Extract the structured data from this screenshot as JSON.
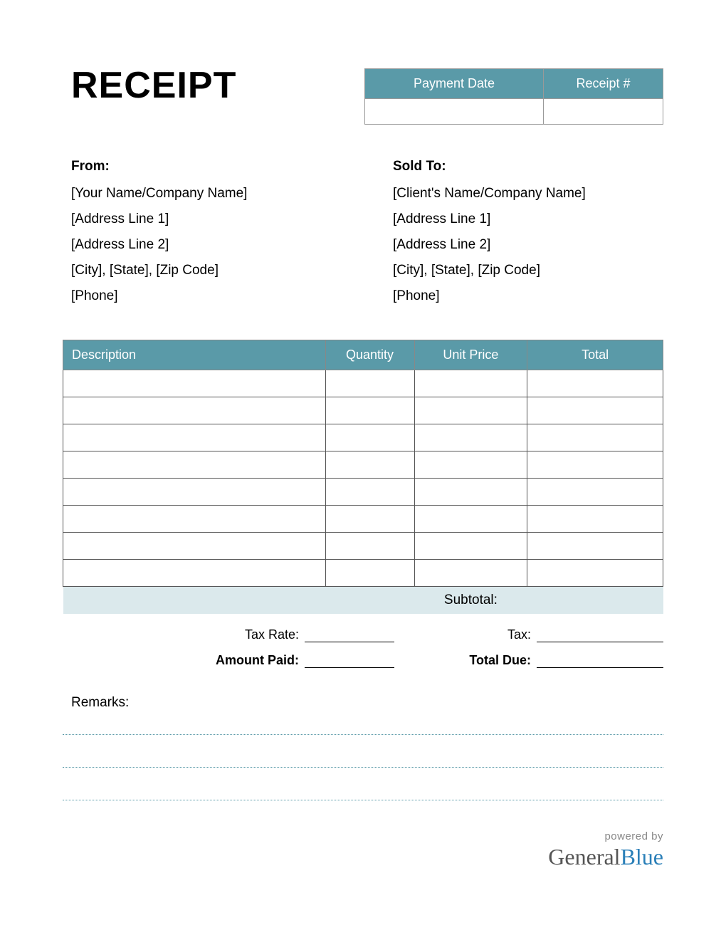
{
  "title": "RECEIPT",
  "meta": {
    "headers": [
      "Payment Date",
      "Receipt #"
    ],
    "values": [
      "",
      ""
    ]
  },
  "from": {
    "heading": "From:",
    "lines": [
      "[Your Name/Company Name]",
      "[Address Line 1]",
      "[Address Line 2]",
      "[City], [State], [Zip Code]",
      "[Phone]"
    ]
  },
  "sold_to": {
    "heading": "Sold To:",
    "lines": [
      "[Client's Name/Company Name]",
      "[Address Line 1]",
      "[Address Line 2]",
      "[City], [State], [Zip Code]",
      "[Phone]"
    ]
  },
  "items": {
    "headers": {
      "description": "Description",
      "quantity": "Quantity",
      "unit_price": "Unit Price",
      "total": "Total"
    },
    "rows": [
      {
        "description": "",
        "quantity": "",
        "unit_price": "",
        "total": ""
      },
      {
        "description": "",
        "quantity": "",
        "unit_price": "",
        "total": ""
      },
      {
        "description": "",
        "quantity": "",
        "unit_price": "",
        "total": ""
      },
      {
        "description": "",
        "quantity": "",
        "unit_price": "",
        "total": ""
      },
      {
        "description": "",
        "quantity": "",
        "unit_price": "",
        "total": ""
      },
      {
        "description": "",
        "quantity": "",
        "unit_price": "",
        "total": ""
      },
      {
        "description": "",
        "quantity": "",
        "unit_price": "",
        "total": ""
      },
      {
        "description": "",
        "quantity": "",
        "unit_price": "",
        "total": ""
      }
    ],
    "subtotal_label": "Subtotal:",
    "subtotal_value": ""
  },
  "totals": {
    "tax_rate_label": "Tax Rate:",
    "tax_rate_value": "",
    "tax_label": "Tax:",
    "tax_value": "",
    "amount_paid_label": "Amount Paid:",
    "amount_paid_value": "",
    "total_due_label": "Total Due:",
    "total_due_value": ""
  },
  "remarks": {
    "label": "Remarks:",
    "lines": [
      "",
      "",
      ""
    ]
  },
  "footer": {
    "powered_by": "powered by",
    "brand_general": "General",
    "brand_blue": "Blue"
  },
  "colors": {
    "accent": "#5a9aa8",
    "subtotal_bg": "#dbe9ec",
    "brand_blue": "#2a7fb8"
  }
}
